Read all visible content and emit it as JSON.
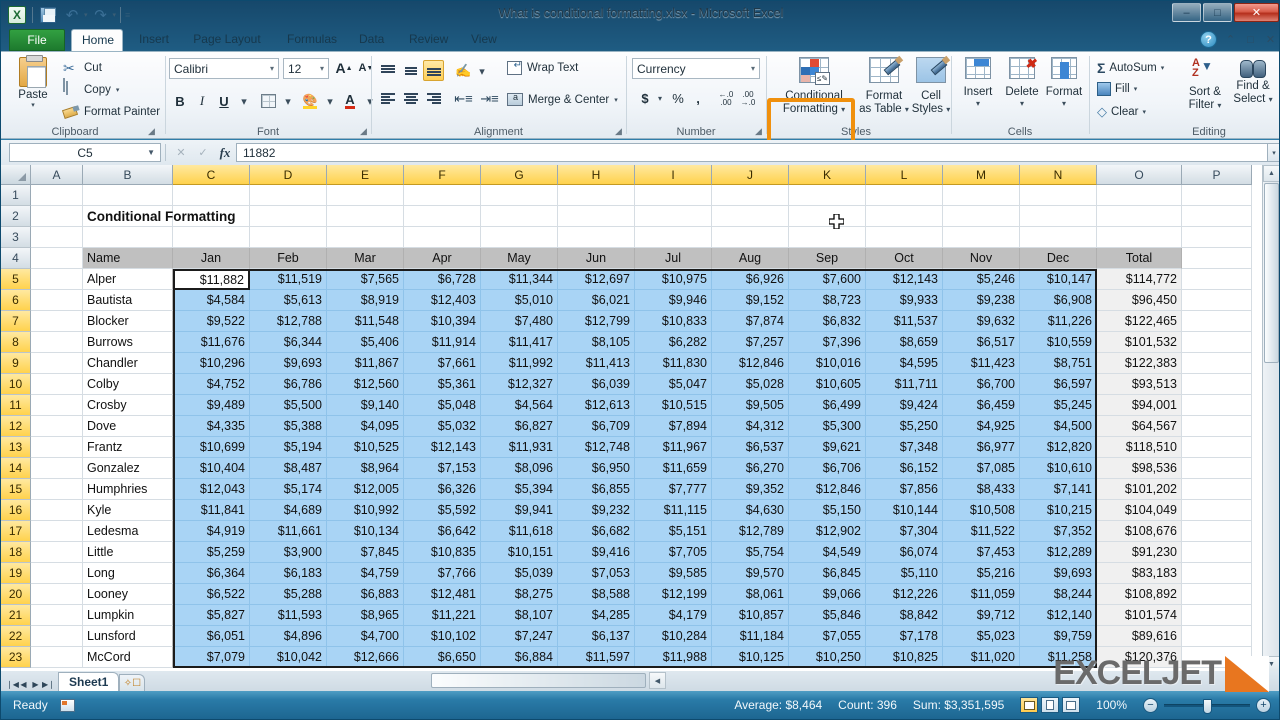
{
  "window": {
    "title": "What is conditional formatting.xlsx  -  Microsoft Excel",
    "minimize": "–",
    "maximize": "□",
    "close": "✕"
  },
  "qat": {
    "logo": "X",
    "save": "save-icon",
    "undo": "↶",
    "redo": "↷",
    "customize": "≡",
    "caret": "▾"
  },
  "ribbon": {
    "tabs": [
      {
        "label": "File",
        "active": false
      },
      {
        "label": "Home",
        "active": true
      },
      {
        "label": "Insert",
        "active": false
      },
      {
        "label": "Page Layout",
        "active": false
      },
      {
        "label": "Formulas",
        "active": false
      },
      {
        "label": "Data",
        "active": false
      },
      {
        "label": "Review",
        "active": false
      },
      {
        "label": "View",
        "active": false
      }
    ],
    "help": "?",
    "minimize_ribbon": "⌃",
    "restore_window": "□",
    "close_window": "✕",
    "groups": {
      "clipboard": {
        "label": "Clipboard",
        "paste": "Paste",
        "cut": "Cut",
        "copy": "Copy",
        "format_painter": "Format Painter",
        "caret": "▾"
      },
      "font": {
        "label": "Font",
        "font_name": "Calibri",
        "font_size": "12",
        "grow_font": "A",
        "shrink_font": "A",
        "bold": "B",
        "italic": "I",
        "underline": "U",
        "borders": "borders-icon",
        "fill_color": "fill-color-icon",
        "font_color": "A",
        "caret": "▾"
      },
      "alignment": {
        "label": "Alignment",
        "top_align": "top-align-icon",
        "middle_align": "middle-align-icon",
        "bottom_align": "bottom-align-icon",
        "orientation": "orientation-icon",
        "align_left": "align-left-icon",
        "align_center": "align-center-icon",
        "align_right": "align-right-icon",
        "decrease_indent": "decrease-indent-icon",
        "increase_indent": "increase-indent-icon",
        "wrap_text": "Wrap Text",
        "merge_center": "Merge & Center",
        "caret": "▾"
      },
      "number": {
        "label": "Number",
        "format": "Currency",
        "accounting": "$",
        "percent": "%",
        "comma": ",",
        "increase_decimal": ".00",
        "decrease_decimal": ".00",
        "caret": "▾"
      },
      "styles": {
        "label": "Styles",
        "conditional_formatting": [
          "Conditional",
          "Formatting"
        ],
        "format_as_table": [
          "Format",
          "as Table"
        ],
        "cell_styles": [
          "Cell",
          "Styles"
        ],
        "caret": "▾",
        "highlight_color": "#f0900d"
      },
      "cells": {
        "label": "Cells",
        "insert": "Insert",
        "delete": "Delete",
        "format": "Format",
        "caret": "▾"
      },
      "editing": {
        "label": "Editing",
        "autosum": "AutoSum",
        "autosum_symbol": "Σ",
        "fill": "Fill",
        "clear": "Clear",
        "sort_filter": [
          "Sort &",
          "Filter"
        ],
        "find_select": [
          "Find &",
          "Select"
        ],
        "caret": "▾"
      }
    }
  },
  "formula_bar": {
    "name_box": "C5",
    "formula": "11882",
    "fx": "fx",
    "cancel": "✕",
    "enter": "✓",
    "expand": "▾"
  },
  "grid": {
    "columns": [
      "A",
      "B",
      "C",
      "D",
      "E",
      "F",
      "G",
      "H",
      "I",
      "J",
      "K",
      "L",
      "M",
      "N",
      "O",
      "P"
    ],
    "selected_columns": [
      "C",
      "D",
      "E",
      "F",
      "G",
      "H",
      "I",
      "J",
      "K",
      "L",
      "M",
      "N"
    ],
    "rows": [
      "1",
      "2",
      "3",
      "4",
      "5",
      "6",
      "7",
      "8",
      "9",
      "10",
      "11",
      "12",
      "13",
      "14",
      "15",
      "16",
      "17",
      "18",
      "19",
      "20",
      "21",
      "22",
      "23"
    ],
    "selected_rows": [
      "5",
      "6",
      "7",
      "8",
      "9",
      "10",
      "11",
      "12",
      "13",
      "14",
      "15",
      "16",
      "17",
      "18",
      "19",
      "20",
      "21",
      "22",
      "23"
    ],
    "sheet_title": "Conditional Formatting",
    "active_cell_value": "$11,882",
    "table_headers": [
      "Name",
      "Jan",
      "Feb",
      "Mar",
      "Apr",
      "May",
      "Jun",
      "Jul",
      "Aug",
      "Sep",
      "Oct",
      "Nov",
      "Dec",
      "Total"
    ],
    "table_rows": [
      {
        "name": "Alper",
        "values": [
          "$11,882",
          "$11,519",
          "$7,565",
          "$6,728",
          "$11,344",
          "$12,697",
          "$10,975",
          "$6,926",
          "$7,600",
          "$12,143",
          "$5,246",
          "$10,147"
        ],
        "total": "$114,772"
      },
      {
        "name": "Bautista",
        "values": [
          "$4,584",
          "$5,613",
          "$8,919",
          "$12,403",
          "$5,010",
          "$6,021",
          "$9,946",
          "$9,152",
          "$8,723",
          "$9,933",
          "$9,238",
          "$6,908"
        ],
        "total": "$96,450"
      },
      {
        "name": "Blocker",
        "values": [
          "$9,522",
          "$12,788",
          "$11,548",
          "$10,394",
          "$7,480",
          "$12,799",
          "$10,833",
          "$7,874",
          "$6,832",
          "$11,537",
          "$9,632",
          "$11,226"
        ],
        "total": "$122,465"
      },
      {
        "name": "Burrows",
        "values": [
          "$11,676",
          "$6,344",
          "$5,406",
          "$11,914",
          "$11,417",
          "$8,105",
          "$6,282",
          "$7,257",
          "$7,396",
          "$8,659",
          "$6,517",
          "$10,559"
        ],
        "total": "$101,532"
      },
      {
        "name": "Chandler",
        "values": [
          "$10,296",
          "$9,693",
          "$11,867",
          "$7,661",
          "$11,992",
          "$11,413",
          "$11,830",
          "$12,846",
          "$10,016",
          "$4,595",
          "$11,423",
          "$8,751"
        ],
        "total": "$122,383"
      },
      {
        "name": "Colby",
        "values": [
          "$4,752",
          "$6,786",
          "$12,560",
          "$5,361",
          "$12,327",
          "$6,039",
          "$5,047",
          "$5,028",
          "$10,605",
          "$11,711",
          "$6,700",
          "$6,597"
        ],
        "total": "$93,513"
      },
      {
        "name": "Crosby",
        "values": [
          "$9,489",
          "$5,500",
          "$9,140",
          "$5,048",
          "$4,564",
          "$12,613",
          "$10,515",
          "$9,505",
          "$6,499",
          "$9,424",
          "$6,459",
          "$5,245"
        ],
        "total": "$94,001"
      },
      {
        "name": "Dove",
        "values": [
          "$4,335",
          "$5,388",
          "$4,095",
          "$5,032",
          "$6,827",
          "$6,709",
          "$7,894",
          "$4,312",
          "$5,300",
          "$5,250",
          "$4,925",
          "$4,500"
        ],
        "total": "$64,567"
      },
      {
        "name": "Frantz",
        "values": [
          "$10,699",
          "$5,194",
          "$10,525",
          "$12,143",
          "$11,931",
          "$12,748",
          "$11,967",
          "$6,537",
          "$9,621",
          "$7,348",
          "$6,977",
          "$12,820"
        ],
        "total": "$118,510"
      },
      {
        "name": "Gonzalez",
        "values": [
          "$10,404",
          "$8,487",
          "$8,964",
          "$7,153",
          "$8,096",
          "$6,950",
          "$11,659",
          "$6,270",
          "$6,706",
          "$6,152",
          "$7,085",
          "$10,610"
        ],
        "total": "$98,536"
      },
      {
        "name": "Humphries",
        "values": [
          "$12,043",
          "$5,174",
          "$12,005",
          "$6,326",
          "$5,394",
          "$6,855",
          "$7,777",
          "$9,352",
          "$12,846",
          "$7,856",
          "$8,433",
          "$7,141"
        ],
        "total": "$101,202"
      },
      {
        "name": "Kyle",
        "values": [
          "$11,841",
          "$4,689",
          "$10,992",
          "$5,592",
          "$9,941",
          "$9,232",
          "$11,115",
          "$4,630",
          "$5,150",
          "$10,144",
          "$10,508",
          "$10,215"
        ],
        "total": "$104,049"
      },
      {
        "name": "Ledesma",
        "values": [
          "$4,919",
          "$11,661",
          "$10,134",
          "$6,642",
          "$11,618",
          "$6,682",
          "$5,151",
          "$12,789",
          "$12,902",
          "$7,304",
          "$11,522",
          "$7,352"
        ],
        "total": "$108,676"
      },
      {
        "name": "Little",
        "values": [
          "$5,259",
          "$3,900",
          "$7,845",
          "$10,835",
          "$10,151",
          "$9,416",
          "$7,705",
          "$5,754",
          "$4,549",
          "$6,074",
          "$7,453",
          "$12,289"
        ],
        "total": "$91,230"
      },
      {
        "name": "Long",
        "values": [
          "$6,364",
          "$6,183",
          "$4,759",
          "$7,766",
          "$5,039",
          "$7,053",
          "$9,585",
          "$9,570",
          "$6,845",
          "$5,110",
          "$5,216",
          "$9,693"
        ],
        "total": "$83,183"
      },
      {
        "name": "Looney",
        "values": [
          "$6,522",
          "$5,288",
          "$6,883",
          "$12,481",
          "$8,275",
          "$8,588",
          "$12,199",
          "$8,061",
          "$9,066",
          "$12,226",
          "$11,059",
          "$8,244"
        ],
        "total": "$108,892"
      },
      {
        "name": "Lumpkin",
        "values": [
          "$5,827",
          "$11,593",
          "$8,965",
          "$11,221",
          "$8,107",
          "$4,285",
          "$4,179",
          "$10,857",
          "$5,846",
          "$8,842",
          "$9,712",
          "$12,140"
        ],
        "total": "$101,574"
      },
      {
        "name": "Lunsford",
        "values": [
          "$6,051",
          "$4,896",
          "$4,700",
          "$10,102",
          "$7,247",
          "$6,137",
          "$10,284",
          "$11,184",
          "$7,055",
          "$7,178",
          "$5,023",
          "$9,759"
        ],
        "total": "$89,616"
      },
      {
        "name": "McCord",
        "values": [
          "$7,079",
          "$10,042",
          "$12,666",
          "$6,650",
          "$6,884",
          "$11,597",
          "$11,988",
          "$10,125",
          "$10,250",
          "$10,825",
          "$11,020",
          "$11,258"
        ],
        "total": "$120,376"
      }
    ]
  },
  "sheet_tabs": {
    "first": "❘◀",
    "prev": "◀",
    "next": "▶",
    "last": "▶❘",
    "tabs": [
      "Sheet1"
    ],
    "new_sheet": "new-sheet-icon"
  },
  "status_bar": {
    "mode": "Ready",
    "macro_icon": "record-macro-icon",
    "average": "Average: $8,464",
    "count": "Count: 396",
    "sum": "Sum: $3,351,595",
    "view_normal": "normal-view-icon",
    "view_layout": "page-layout-view-icon",
    "view_break": "page-break-view-icon",
    "zoom": "100%",
    "zoom_out": "−",
    "zoom_in": "+"
  },
  "watermark": {
    "text": "EXCELJET",
    "mark": "exceljet-logo"
  },
  "cursor": "cell-cross-cursor"
}
